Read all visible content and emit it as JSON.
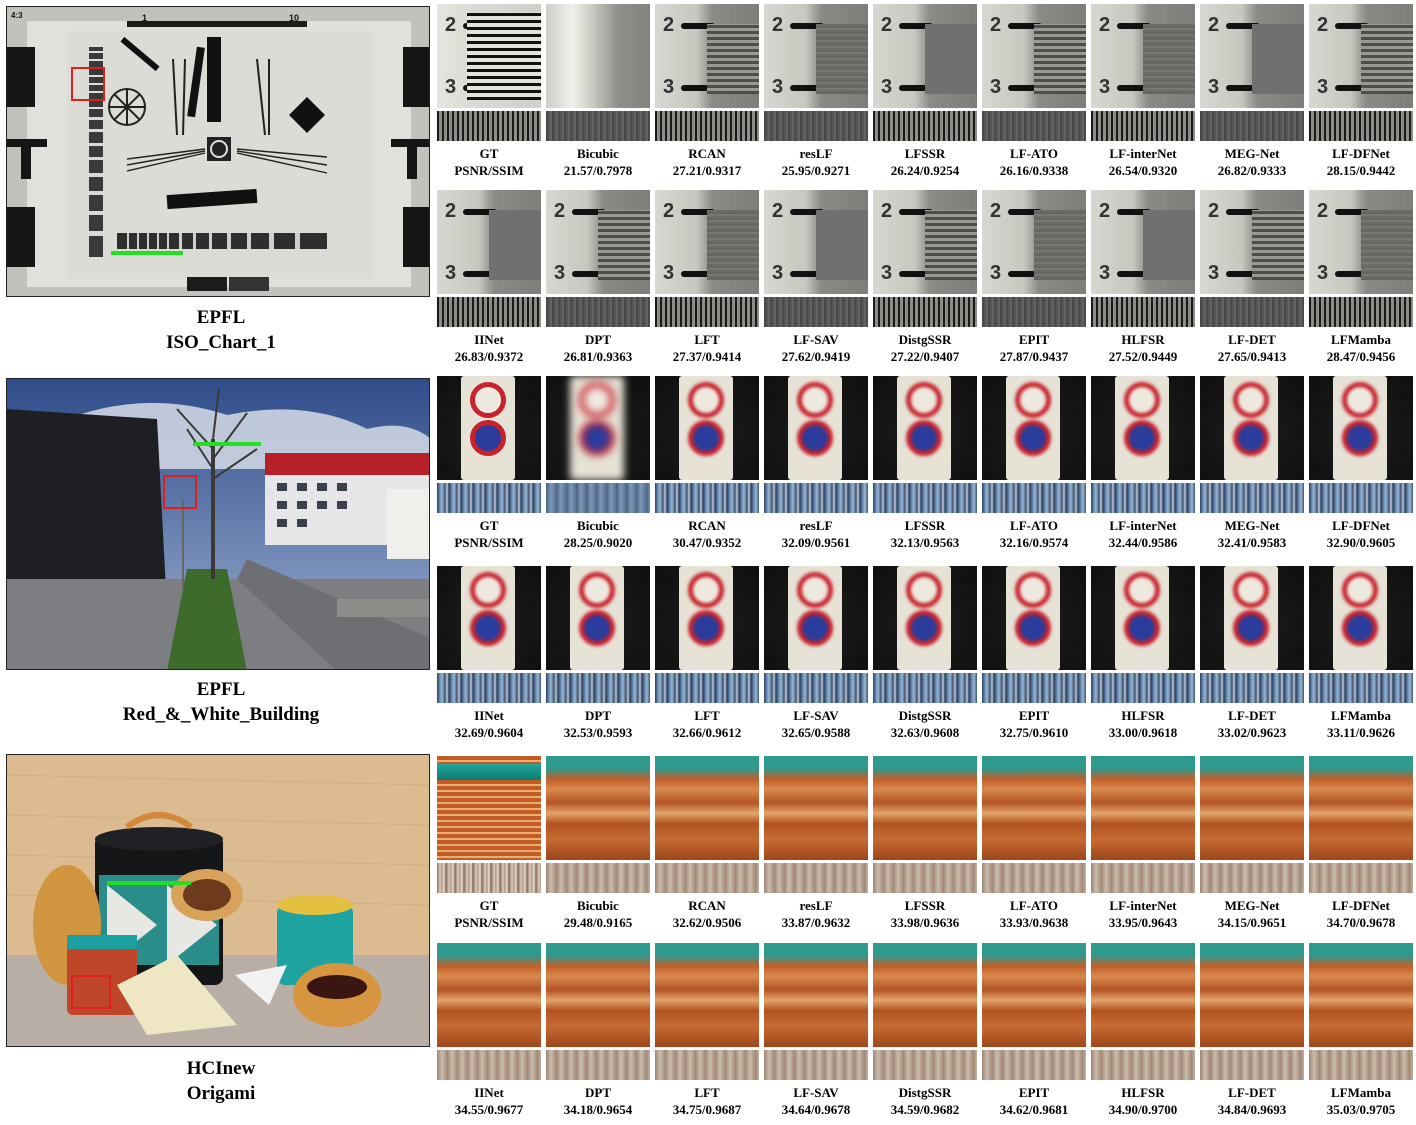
{
  "scenes": [
    {
      "dataset": "EPFL",
      "name": "ISO_Chart_1",
      "rows": [
        {
          "labels": [
            "GT",
            "Bicubic",
            "RCAN",
            "resLF",
            "LFSSR",
            "LF-ATO",
            "LF-interNet",
            "MEG-Net",
            "LF-DFNet"
          ],
          "scores": [
            "PSNR/SSIM",
            "21.57/0.7978",
            "27.21/0.9317",
            "25.95/0.9271",
            "26.24/0.9254",
            "26.16/0.9338",
            "26.54/0.9320",
            "26.82/0.9333",
            "28.15/0.9442"
          ]
        },
        {
          "labels": [
            "IINet",
            "DPT",
            "LFT",
            "LF-SAV",
            "DistgSSR",
            "EPIT",
            "HLFSR",
            "LF-DET",
            "LFMamba"
          ],
          "scores": [
            "26.83/0.9372",
            "26.81/0.9363",
            "27.37/0.9414",
            "27.62/0.9419",
            "27.22/0.9407",
            "27.87/0.9437",
            "27.52/0.9449",
            "27.65/0.9413",
            "28.47/0.9456"
          ]
        }
      ]
    },
    {
      "dataset": "EPFL",
      "name": "Red_&_White_Building",
      "rows": [
        {
          "labels": [
            "GT",
            "Bicubic",
            "RCAN",
            "resLF",
            "LFSSR",
            "LF-ATO",
            "LF-interNet",
            "MEG-Net",
            "LF-DFNet"
          ],
          "scores": [
            "PSNR/SSIM",
            "28.25/0.9020",
            "30.47/0.9352",
            "32.09/0.9561",
            "32.13/0.9563",
            "32.16/0.9574",
            "32.44/0.9586",
            "32.41/0.9583",
            "32.90/0.9605"
          ]
        },
        {
          "labels": [
            "IINet",
            "DPT",
            "LFT",
            "LF-SAV",
            "DistgSSR",
            "EPIT",
            "HLFSR",
            "LF-DET",
            "LFMamba"
          ],
          "scores": [
            "32.69/0.9604",
            "32.53/0.9593",
            "32.66/0.9612",
            "32.65/0.9588",
            "32.63/0.9608",
            "32.75/0.9610",
            "33.00/0.9618",
            "33.02/0.9623",
            "33.11/0.9626"
          ]
        }
      ]
    },
    {
      "dataset": "HCInew",
      "name": "Origami",
      "rows": [
        {
          "labels": [
            "GT",
            "Bicubic",
            "RCAN",
            "resLF",
            "LFSSR",
            "LF-ATO",
            "LF-interNet",
            "MEG-Net",
            "LF-DFNet"
          ],
          "scores": [
            "PSNR/SSIM",
            "29.48/0.9165",
            "32.62/0.9506",
            "33.87/0.9632",
            "33.98/0.9636",
            "33.93/0.9638",
            "33.95/0.9643",
            "34.15/0.9651",
            "34.70/0.9678"
          ]
        },
        {
          "labels": [
            "IINet",
            "DPT",
            "LFT",
            "LF-SAV",
            "DistgSSR",
            "EPIT",
            "HLFSR",
            "LF-DET",
            "LFMamba"
          ],
          "scores": [
            "34.55/0.9677",
            "34.18/0.9654",
            "34.75/0.9687",
            "34.64/0.9678",
            "34.59/0.9682",
            "34.62/0.9681",
            "34.90/0.9700",
            "34.84/0.9693",
            "35.03/0.9705"
          ]
        }
      ]
    }
  ],
  "chart_text": {
    "top_ruler_left": "1",
    "top_ruler_right": "10",
    "corner_ratio": "4:3",
    "chart_nums": [
      "2",
      "3"
    ]
  },
  "colors": {
    "highlight_box": "#e02020",
    "epi_line": "#22e022"
  }
}
